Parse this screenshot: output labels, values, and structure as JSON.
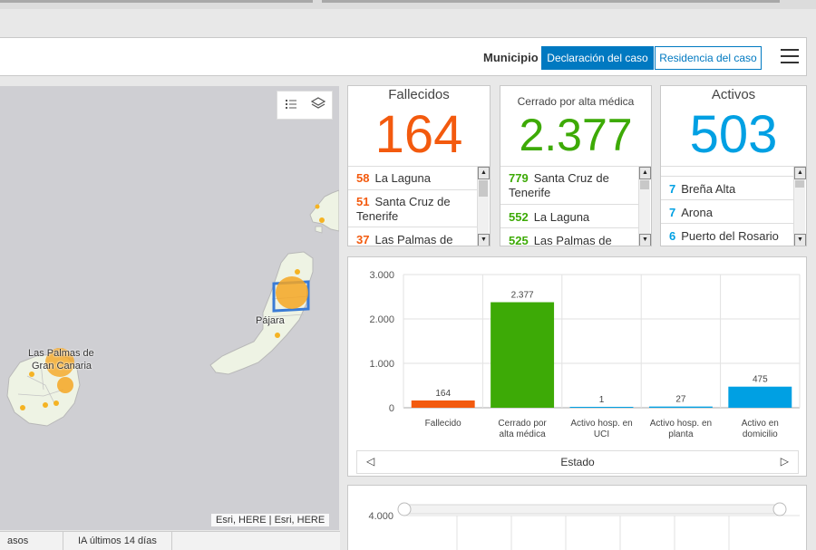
{
  "header": {
    "municipio_label": "Municipio",
    "btn_declaracion": "Declaración del caso",
    "btn_residencia": "Residencia del caso"
  },
  "map": {
    "label_palmas_line1": "Las Palmas de",
    "label_palmas_line2": "Gran Canaria",
    "label_pajara": "Pájara",
    "attribution": "Esri, HERE | Esri, HERE"
  },
  "tabs": {
    "tab1": "asos activos",
    "tab2": "IA últimos 14 días"
  },
  "cards": {
    "fallecidos": {
      "title": "Fallecidos",
      "value": "164",
      "color": "#f35a0e",
      "items": [
        {
          "num": "58",
          "name": "La Laguna"
        },
        {
          "num": "51",
          "name": "Santa Cruz de Tenerife"
        },
        {
          "num": "37",
          "name": "Las Palmas de"
        }
      ]
    },
    "cerrado": {
      "title": "Cerrado por alta médica",
      "value": "2.377",
      "color": "#3daa06",
      "items": [
        {
          "num": "779",
          "name": "Santa Cruz de Tenerife"
        },
        {
          "num": "552",
          "name": "La Laguna"
        },
        {
          "num": "525",
          "name": "Las Palmas de"
        }
      ]
    },
    "activos": {
      "title": "Activos",
      "value": "503",
      "color": "#00a0e3",
      "items": [
        {
          "num": "7",
          "name": "Breña Alta"
        },
        {
          "num": "7",
          "name": "Arona"
        },
        {
          "num": "6",
          "name": "Puerto del Rosario"
        }
      ]
    }
  },
  "chart_footer": {
    "label": "Estado"
  },
  "chart_data": [
    {
      "type": "bar",
      "categories": [
        "Fallecido",
        "Cerrado por alta médica",
        "Activo hosp. en UCI",
        "Activo hosp. en planta",
        "Activo en domicilio"
      ],
      "category_lines": [
        [
          "Fallecido"
        ],
        [
          "Cerrado por",
          "alta médica"
        ],
        [
          "Activo hosp. en",
          "UCI"
        ],
        [
          "Activo hosp. en",
          "planta"
        ],
        [
          "Activo en",
          "domicilio"
        ]
      ],
      "values": [
        164,
        2377,
        1,
        27,
        475
      ],
      "value_labels": [
        "164",
        "2.377",
        "1",
        "27",
        "475"
      ],
      "colors": [
        "#f35a0e",
        "#3daa06",
        "#00a0e3",
        "#00a0e3",
        "#00a0e3"
      ],
      "ylim": [
        0,
        3000
      ],
      "yticks": [
        0,
        1000,
        2000,
        3000
      ],
      "ytick_labels": [
        "0",
        "1.000",
        "2.000",
        "3.000"
      ],
      "xlabel": "Estado",
      "grid": true
    },
    {
      "type": "line",
      "ytick_labels": [
        "4.000"
      ],
      "grid": true
    }
  ]
}
